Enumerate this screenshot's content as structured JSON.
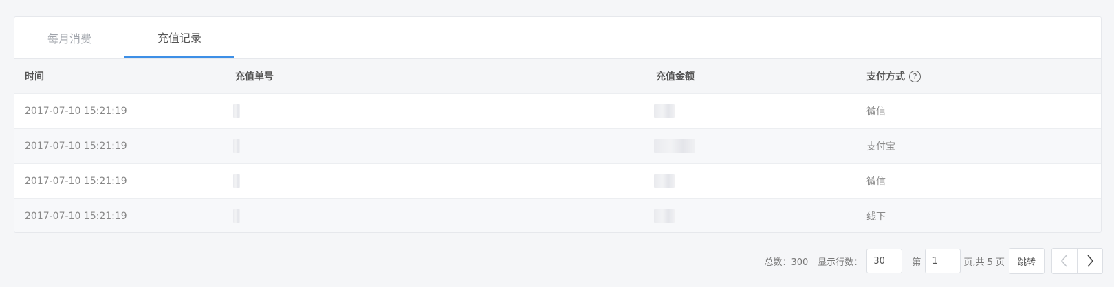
{
  "tabs": [
    {
      "label": "每月消费"
    },
    {
      "label": "充值记录"
    }
  ],
  "table": {
    "columns": [
      "时间",
      "充值单号",
      "充值金额",
      "支付方式"
    ],
    "help_icon": "question-circle-icon",
    "rows": [
      {
        "time": "2017-07-10 15:21:19",
        "method": "微信"
      },
      {
        "time": "2017-07-10 15:21:19",
        "method": "支付宝"
      },
      {
        "time": "2017-07-10 15:21:19",
        "method": "微信"
      },
      {
        "time": "2017-07-10 15:21:19",
        "method": "线下"
      }
    ]
  },
  "pager": {
    "total_label": "总数：300",
    "rows_label": "显示行数：",
    "rows_value": "30",
    "page_prefix": "第",
    "page_value": "1",
    "page_suffix": "页,共 5 页",
    "jump_label": "跳转",
    "prev_icon": "chevron-left-icon",
    "next_icon": "chevron-right-icon"
  },
  "colors": {
    "accent": "#3d8fe6",
    "background": "#f5f6f8"
  }
}
